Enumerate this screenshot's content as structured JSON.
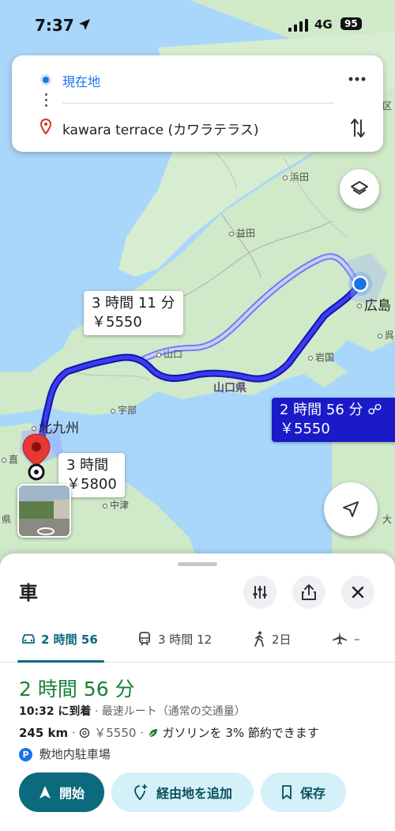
{
  "status_bar": {
    "time": "7:37",
    "network": "4G",
    "battery": "95"
  },
  "search": {
    "origin": "現在地",
    "destination": "kawara terrace (カワラテラス)"
  },
  "map": {
    "places": [
      "浜田",
      "益田",
      "広島",
      "呉",
      "岩国",
      "山口",
      "宇部",
      "北九州",
      "中津",
      "直",
      "県",
      "大",
      "区"
    ],
    "prefecture_label": "山口県",
    "routes": [
      {
        "time": "3 時間 11 分",
        "price": "￥5550"
      },
      {
        "time": "2 時間 56 分",
        "price": "￥5550"
      },
      {
        "time": "3 時間",
        "price": "￥5800"
      }
    ]
  },
  "sheet": {
    "title": "車",
    "tabs": [
      {
        "label": "2 時間 56",
        "icon": "car-icon"
      },
      {
        "label": "3 時間 12",
        "icon": "train-icon"
      },
      {
        "label": "2日",
        "icon": "walk-icon"
      },
      {
        "label": "–",
        "icon": "plane-icon"
      }
    ],
    "duration": "2 時間 56 分",
    "arrival": "10:32 に到着",
    "route_desc": "· 最速ルート（通常の交通量）",
    "distance": "245 km",
    "toll": "￥5550",
    "fuel_note": "ガソリンを 3% 節約できます",
    "parking": "敷地内駐車場",
    "parking_badge": "P",
    "buttons": {
      "start": "開始",
      "add_stop": "経由地を追加",
      "save": "保存"
    }
  },
  "colors": {
    "accent": "#0b6a7e",
    "route_selected": "#1a1ac8",
    "duration_green": "#188038",
    "link_blue": "#1a73e8"
  }
}
